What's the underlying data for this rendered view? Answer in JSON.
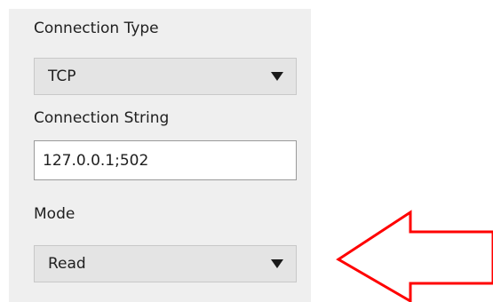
{
  "connection_type": {
    "label": "Connection Type",
    "selected": "TCP"
  },
  "connection_string": {
    "label": "Connection String",
    "value": "127.0.0.1;502"
  },
  "mode": {
    "label": "Mode",
    "selected": "Read"
  },
  "annotation": {
    "arrow_color": "#ff0000",
    "icon": "left-arrow-icon"
  },
  "colors": {
    "panel_background": "#efefef",
    "dropdown_background": "#e4e4e4",
    "text": "#202020"
  }
}
